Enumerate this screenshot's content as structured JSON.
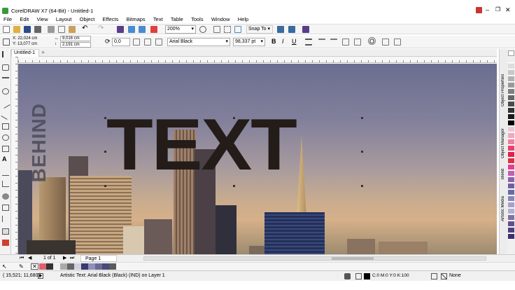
{
  "window": {
    "title": "CorelDRAW X7 (64-Bit) - Untitled-1",
    "controls": [
      "minimize",
      "maximize",
      "close"
    ]
  },
  "menu": [
    "File",
    "Edit",
    "View",
    "Layout",
    "Object",
    "Effects",
    "Bitmaps",
    "Text",
    "Table",
    "Tools",
    "Window",
    "Help"
  ],
  "toolbar": {
    "zoom": "200%",
    "snap_to": "Snap To"
  },
  "property_bar": {
    "x": "X: 22,024 cm",
    "y": "Y: 13,077 cm",
    "width": "9,016 cm",
    "height": "2,191 cm",
    "rotation": "0,0",
    "font": "Arial Black",
    "font_size": "98,337 pt"
  },
  "document": {
    "tab": "Untitled-1",
    "page_nav": "1 of 1",
    "page_tab": "Page 1"
  },
  "canvas": {
    "main_text": "TEXT",
    "vertical_text": "BEHIND"
  },
  "dockers": [
    "Object Properties",
    "Object Manager",
    "Blend",
    "Artistic Media"
  ],
  "status": {
    "coords": "( 15,521; 11,680 )",
    "info": "Artistic Text: Arial Black (Black) (IND) on Layer 1",
    "fill": "C:0 M:0 Y:0 K:100",
    "outline": "None"
  },
  "colors": {
    "text": "#231c18",
    "accent": "#2a5fb0"
  }
}
